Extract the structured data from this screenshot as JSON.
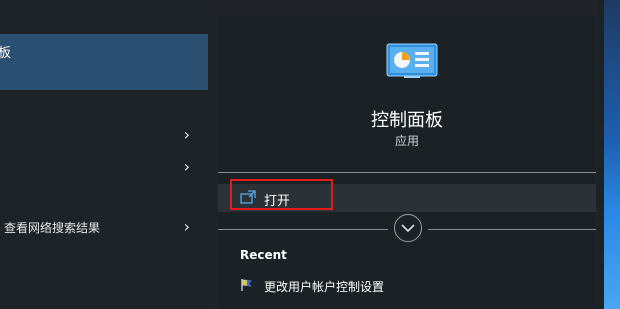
{
  "left": {
    "best_match_label": "板",
    "web_search_label": "查看网络搜索结果",
    "chevron": "›"
  },
  "detail": {
    "title": "控制面板",
    "subtitle": "应用",
    "icon": "control-panel-icon",
    "open_label": "打开",
    "open_icon": "open-window-icon",
    "expand_icon": "chevron-down-icon"
  },
  "recent": {
    "heading": "Recent",
    "items": [
      {
        "label": "更改用户帐户控制设置",
        "icon": "uac-flag-icon"
      }
    ]
  },
  "colors": {
    "selection": "#2b4f70",
    "highlight_box": "#e41b1b",
    "pane_bg": "#1b2226"
  }
}
